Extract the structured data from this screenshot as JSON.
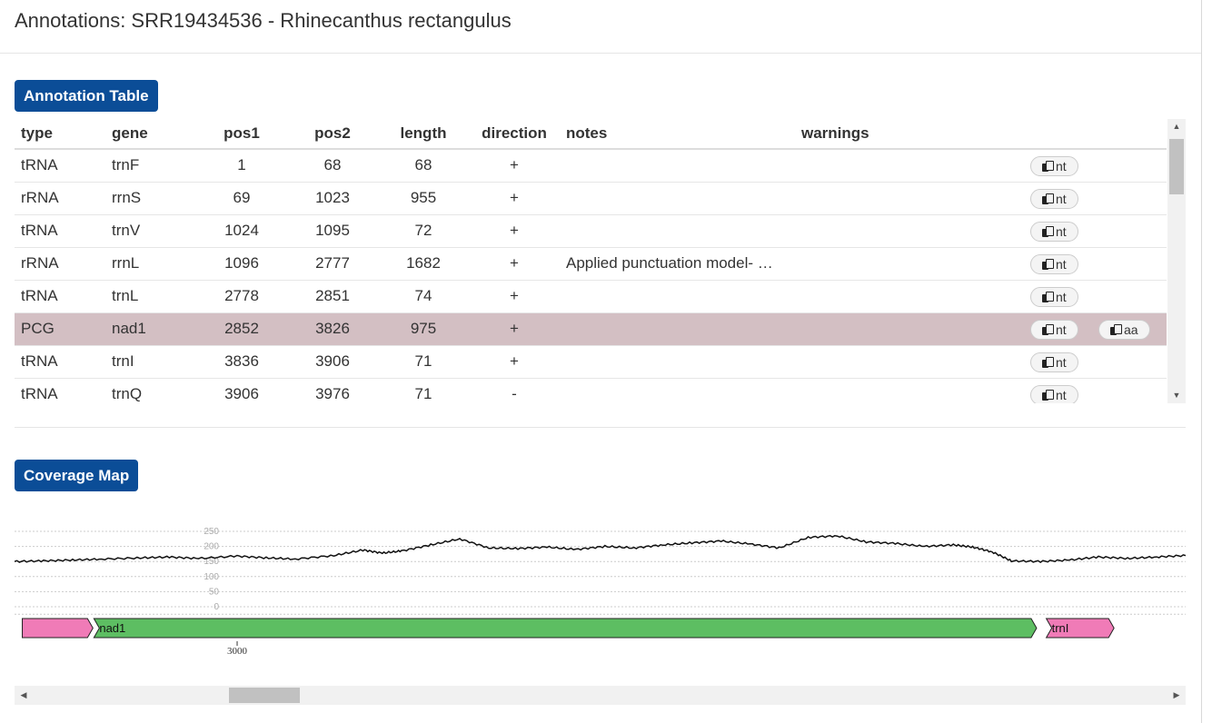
{
  "page": {
    "title": "Annotations: SRR19434536 - Rhinecanthus rectangulus"
  },
  "sections": {
    "table_button": "Annotation Table",
    "coverage_button": "Coverage Map"
  },
  "table": {
    "headers": {
      "type": "type",
      "gene": "gene",
      "pos1": "pos1",
      "pos2": "pos2",
      "length": "length",
      "direction": "direction",
      "notes": "notes",
      "warnings": "warnings"
    },
    "nt_label": "nt",
    "aa_label": "aa",
    "rows": [
      {
        "type": "tRNA",
        "gene": "trnF",
        "pos1": "1",
        "pos2": "68",
        "length": "68",
        "direction": "+",
        "notes": "",
        "warnings": ""
      },
      {
        "type": "rRNA",
        "gene": "rrnS",
        "pos1": "69",
        "pos2": "1023",
        "length": "955",
        "direction": "+",
        "notes": "",
        "warnings": ""
      },
      {
        "type": "tRNA",
        "gene": "trnV",
        "pos1": "1024",
        "pos2": "1095",
        "length": "72",
        "direction": "+",
        "notes": "",
        "warnings": ""
      },
      {
        "type": "rRNA",
        "gene": "rrnL",
        "pos1": "1096",
        "pos2": "2777",
        "length": "1682",
        "direction": "+",
        "notes": "Applied punctuation model- …",
        "warnings": ""
      },
      {
        "type": "tRNA",
        "gene": "trnL",
        "pos1": "2778",
        "pos2": "2851",
        "length": "74",
        "direction": "+",
        "notes": "",
        "warnings": ""
      },
      {
        "type": "PCG",
        "gene": "nad1",
        "pos1": "2852",
        "pos2": "3826",
        "length": "975",
        "direction": "+",
        "notes": "",
        "warnings": ""
      },
      {
        "type": "tRNA",
        "gene": "trnI",
        "pos1": "3836",
        "pos2": "3906",
        "length": "71",
        "direction": "+",
        "notes": "",
        "warnings": ""
      },
      {
        "type": "tRNA",
        "gene": "trnQ",
        "pos1": "3906",
        "pos2": "3976",
        "length": "71",
        "direction": "-",
        "notes": "",
        "warnings": ""
      }
    ],
    "highlighted_row_index": 5
  },
  "chart_data": {
    "type": "line",
    "x_range": [
      2770,
      3980
    ],
    "ylim": [
      0,
      250
    ],
    "y_ticks": [
      "250",
      "200",
      "150",
      "100",
      "50",
      "0"
    ],
    "x_ticks": [
      "3000"
    ],
    "grid": true,
    "series": [
      {
        "x": [
          2770,
          2800,
          2830,
          2860,
          2900,
          2930,
          2960,
          3000,
          3030,
          3060,
          3100,
          3130,
          3150,
          3170,
          3200,
          3230,
          3260,
          3290,
          3320,
          3350,
          3380,
          3410,
          3440,
          3470,
          3500,
          3530,
          3560,
          3590,
          3620,
          3650,
          3680,
          3710,
          3740,
          3760,
          3780,
          3800,
          3830,
          3860,
          3890,
          3920,
          3950,
          3980
        ],
        "y": [
          150,
          152,
          155,
          158,
          162,
          165,
          160,
          168,
          162,
          158,
          170,
          188,
          178,
          185,
          205,
          225,
          195,
          193,
          198,
          190,
          200,
          195,
          205,
          212,
          218,
          208,
          195,
          230,
          235,
          215,
          210,
          200,
          205,
          198,
          182,
          152,
          150,
          155,
          165,
          160,
          165,
          170
        ]
      }
    ],
    "tracks": [
      {
        "name": "",
        "start": 2778,
        "end": 2851,
        "color": "#f07bb7",
        "strand": "+"
      },
      {
        "name": "nad1",
        "start": 2852,
        "end": 3826,
        "color": "#5dbe62",
        "strand": "+"
      },
      {
        "name": "trnI",
        "start": 3836,
        "end": 3906,
        "color": "#f07bb7",
        "strand": "+"
      }
    ]
  },
  "scrollbars": {
    "up": "▲",
    "down": "▼",
    "left": "◀",
    "right": "▶"
  }
}
